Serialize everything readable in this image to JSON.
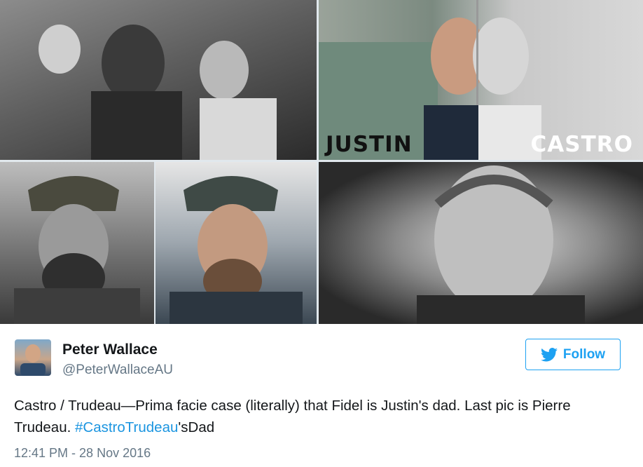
{
  "media": {
    "tiles": [
      {
        "label": ""
      },
      {
        "left_label": "JUSTIN",
        "right_label": "CASTRO"
      },
      {
        "label": ""
      },
      {
        "label": ""
      },
      {
        "label": ""
      }
    ]
  },
  "tweet": {
    "author": {
      "display_name": "Peter Wallace",
      "handle": "@PeterWallaceAU",
      "avatar_icon": "profile-photo"
    },
    "follow_button": {
      "label": "Follow",
      "icon": "twitter-bird-icon",
      "color": "#1da1f2"
    },
    "text_part1": "Castro / Trudeau—Prima facie case (literally) that Fidel is Justin's dad. Last pic is Pierre Trudeau. ",
    "hashtag": "#CastroTrudeau",
    "text_part2": "'sDad",
    "timestamp": "12:41 PM - 28 Nov 2016"
  },
  "colors": {
    "accent": "#1da1f2",
    "hashtag": "#1b95e0",
    "secondary_text": "#657786"
  }
}
